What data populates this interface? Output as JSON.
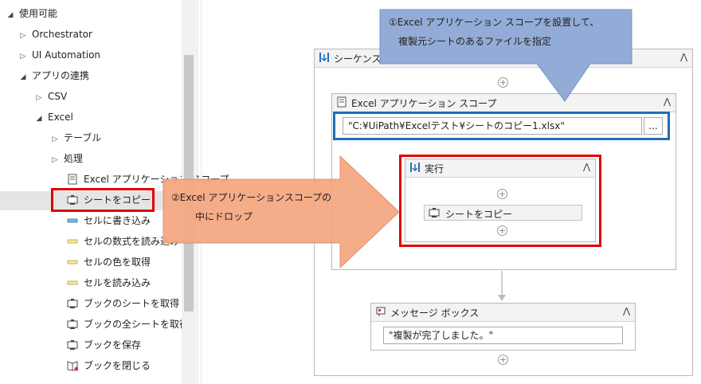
{
  "tree": {
    "items": [
      {
        "label": "使用可能",
        "arrow": "◢"
      },
      {
        "label": "Orchestrator",
        "arrow": "▷"
      },
      {
        "label": "UI Automation",
        "arrow": "▷"
      },
      {
        "label": "アプリの連携",
        "arrow": "◢"
      },
      {
        "label": "CSV",
        "arrow": "▷"
      },
      {
        "label": "Excel",
        "arrow": "◢"
      },
      {
        "label": "テーブル",
        "arrow": "▷"
      },
      {
        "label": "処理",
        "arrow": "▷"
      },
      {
        "label": "Excel アプリケーション スコープ",
        "icon": "excel-scope-icon"
      },
      {
        "label": "シートをコピー",
        "icon": "copy-sheet-icon"
      },
      {
        "label": "セルに書き込み",
        "icon": "write-cell-icon"
      },
      {
        "label": "セルの数式を読み込み",
        "icon": "read-formula-icon"
      },
      {
        "label": "セルの色を取得",
        "icon": "get-color-icon"
      },
      {
        "label": "セルを読み込み",
        "icon": "read-cell-icon"
      },
      {
        "label": "ブックのシートを取得",
        "icon": "get-sheet-icon"
      },
      {
        "label": "ブックの全シートを取得",
        "icon": "get-all-sheets-icon"
      },
      {
        "label": "ブックを保存",
        "icon": "save-book-icon"
      },
      {
        "label": "ブックを閉じる",
        "icon": "close-book-icon"
      }
    ]
  },
  "callout1": {
    "line1": "①Excel アプリケーション スコープを設置して、",
    "line2": "複製元シートのあるファイルを指定"
  },
  "callout2": {
    "line1": "②Excel アプリケーションスコープの",
    "line2": "中にドロップ"
  },
  "sequence": {
    "title": "シーケンス",
    "collapse": "⋀"
  },
  "scope": {
    "title": "Excel アプリケーション スコープ",
    "path": "\"C:¥UiPath¥Excelテスト¥シートのコピー1.xlsx\"",
    "browse": "...",
    "collapse": "⋀"
  },
  "execute": {
    "title": "実行",
    "collapse": "⋀",
    "activity": "シートをコピー"
  },
  "message": {
    "title": "メッセージ ボックス",
    "text": "\"複製が完了しました。\"",
    "collapse": "⋀"
  },
  "plus": "+",
  "colors": {
    "red": "#e00000",
    "blue": "#1f6fb5",
    "callout_blue": "#8fa9d6",
    "arrow_orange": "#f5a882"
  }
}
